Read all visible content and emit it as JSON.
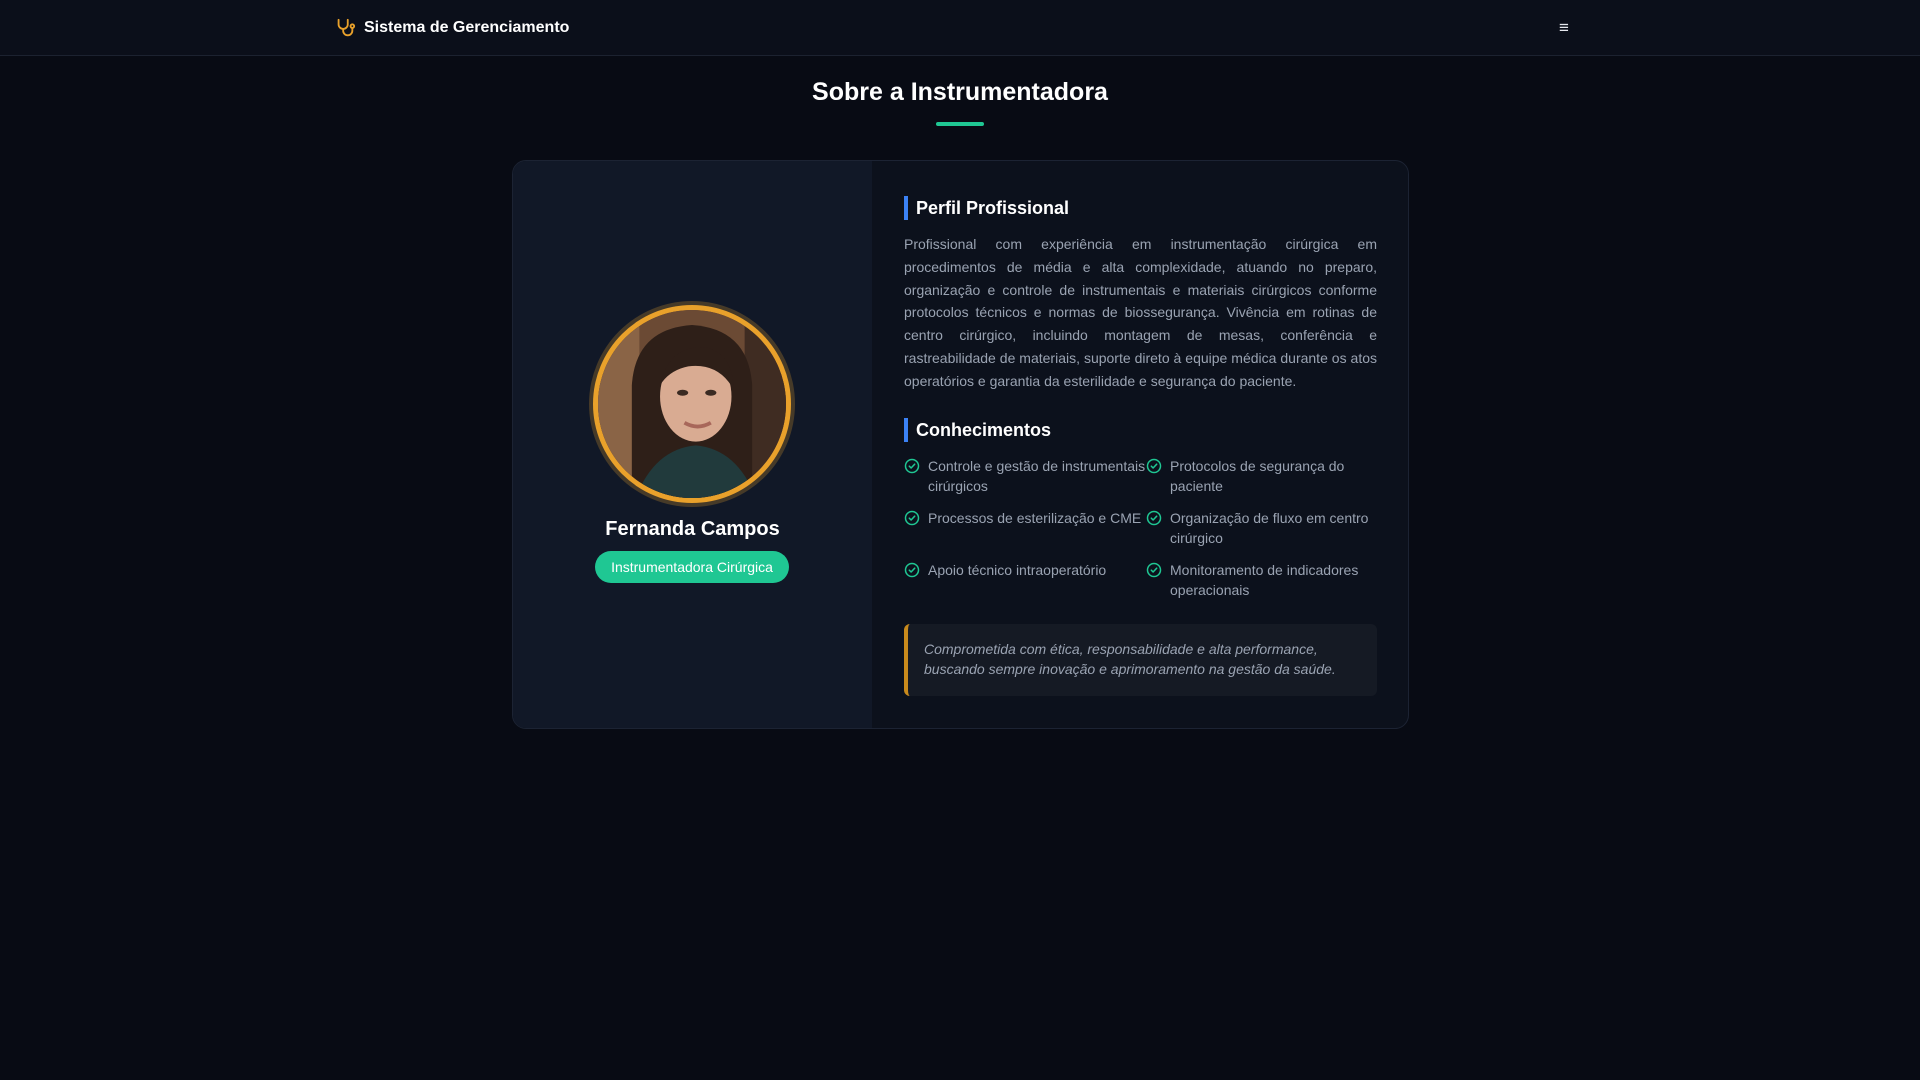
{
  "navbar": {
    "brand_name": "Sistema de Gerenciamento",
    "brand_icon": "stethoscope-icon",
    "menu_icon": "hamburger-menu-icon",
    "menu_glyph": "≡"
  },
  "page": {
    "title": "Sobre a Instrumentadora"
  },
  "profile": {
    "name": "Fernanda Campos",
    "role": "Instrumentadora Cirúrgica"
  },
  "sections": {
    "profile_heading": "Perfil Profissional",
    "profile_text": "Profissional com experiência em instrumentação cirúrgica em procedimentos de média e alta complexidade, atuando no preparo, organização e controle de instrumentais e materiais cirúrgicos conforme protocolos técnicos e normas de biossegurança. Vivência em rotinas de centro cirúrgico, incluindo montagem de mesas, conferência e rastreabilidade de materiais, suporte direto à equipe médica durante os atos operatórios e garantia da esterilidade e segurança do paciente.",
    "knowledge_heading": "Conhecimentos",
    "skills": [
      "Controle e gestão de instrumentais cirúrgicos",
      "Protocolos de segurança do paciente",
      "Processos de esterilização e CME",
      "Organização de fluxo em centro cirúrgico",
      "Apoio técnico intraoperatório",
      "Monitoramento de indicadores operacionais"
    ],
    "quote": "Comprometida com ética, responsabilidade e alta performance, buscando sempre inovação e aprimoramento na gestão da saúde."
  },
  "colors": {
    "background": "#080b14",
    "accent_green": "#1fc793",
    "accent_blue": "#3b82f6",
    "accent_gold": "#e9a12b"
  }
}
